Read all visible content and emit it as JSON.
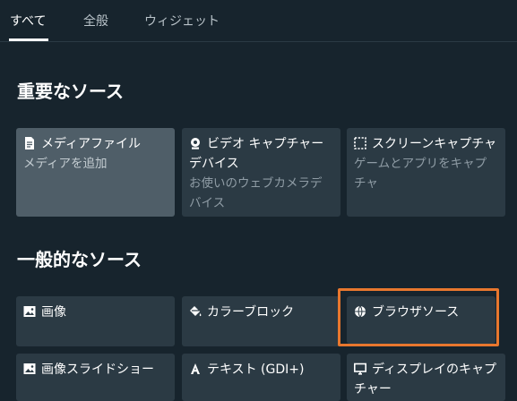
{
  "tabs": [
    {
      "label": "すべて"
    },
    {
      "label": "全般"
    },
    {
      "label": "ウィジェット"
    }
  ],
  "sections": {
    "important": {
      "title": "重要なソース"
    },
    "general": {
      "title": "一般的なソース"
    }
  },
  "cards": {
    "media": {
      "title": "メディアファイル",
      "desc": "メディアを追加",
      "icon": "file-icon"
    },
    "video": {
      "title": "ビデオ キャプチャーデバイス",
      "desc": "お使いのウェブカメラデバイス",
      "icon": "webcam-icon"
    },
    "screen": {
      "title": "スクリーンキャプチャ",
      "desc": "ゲームとアプリをキャプチャ",
      "icon": "screen-capture-icon"
    },
    "image": {
      "title": "画像",
      "icon": "image-icon"
    },
    "color": {
      "title": "カラーブロック",
      "icon": "paint-bucket-icon"
    },
    "browser": {
      "title": "ブラウザソース",
      "icon": "globe-icon"
    },
    "slideshow": {
      "title": "画像スライドショー",
      "icon": "image-icon"
    },
    "text": {
      "title": "テキスト (GDI+)",
      "icon": "text-icon"
    },
    "display": {
      "title": "ディスプレイのキャプチャー",
      "icon": "monitor-icon"
    }
  },
  "colors": {
    "background": "#17242d",
    "card": "#2b3a44",
    "card_selected": "#4f5e68",
    "highlight": "#e8772e"
  }
}
